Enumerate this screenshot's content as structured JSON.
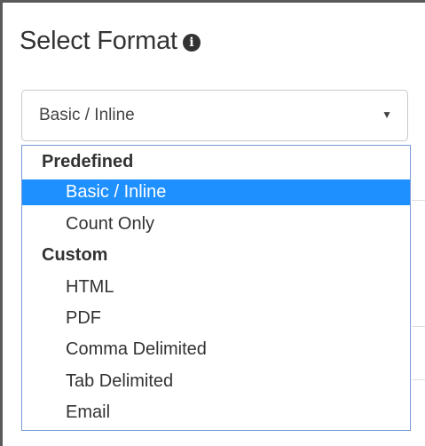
{
  "title": {
    "text": "Select Format",
    "info_icon": "info-icon"
  },
  "select": {
    "value": "Basic / Inline",
    "arrow_icon": "triangle-down-icon"
  },
  "dropdown": {
    "groups": [
      {
        "label": "Predefined",
        "options": [
          "Basic / Inline",
          "Count Only"
        ]
      },
      {
        "label": "Custom",
        "options": [
          "HTML",
          "PDF",
          "Comma Delimited",
          "Tab Delimited",
          "Email"
        ]
      }
    ],
    "selected": "Basic / Inline",
    "selected_color": "#1e90ff",
    "border_color": "#7a9bd8"
  }
}
